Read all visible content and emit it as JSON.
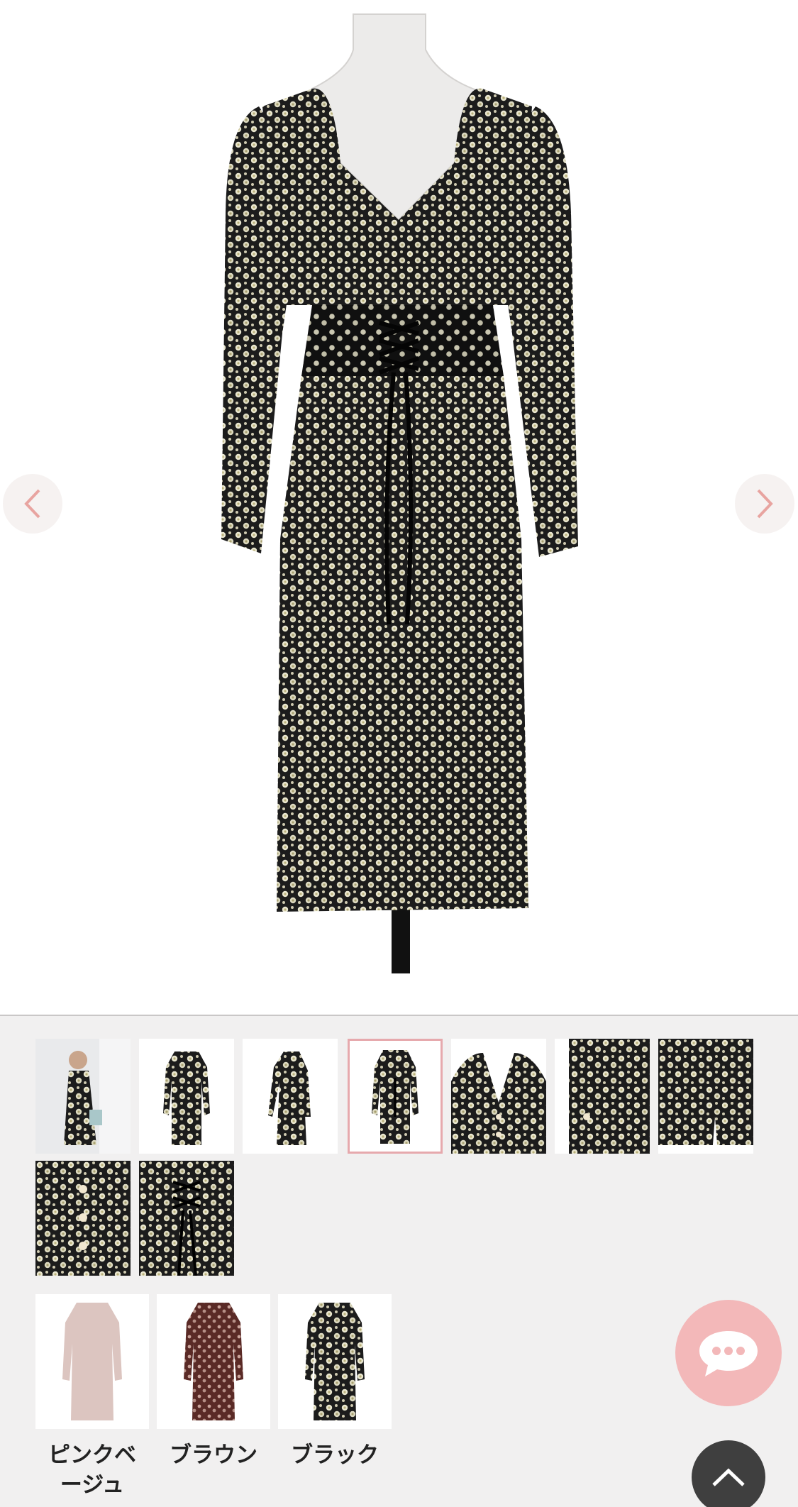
{
  "hero": {
    "prev_icon": "chevron-left-icon",
    "next_icon": "chevron-right-icon",
    "accent_color": "#e8a4a0"
  },
  "gallery": {
    "thumbnails": [
      {
        "name": "model-photo",
        "active": false
      },
      {
        "name": "front",
        "active": false
      },
      {
        "name": "side",
        "active": false
      },
      {
        "name": "back",
        "active": true
      },
      {
        "name": "neckline-detail",
        "active": false
      },
      {
        "name": "cuff-detail",
        "active": false
      },
      {
        "name": "hem-detail",
        "active": false
      },
      {
        "name": "button-detail",
        "active": false
      },
      {
        "name": "lace-up-detail",
        "active": false
      }
    ],
    "active_border_color": "#e6a9ad"
  },
  "colors": {
    "options": [
      {
        "label": "ピンクベージュ",
        "line1": "ピンクベ",
        "line2": "ージュ",
        "swatch": "#d9c2bd"
      },
      {
        "label": "ブラウン",
        "line1": "ブラウン",
        "line2": "",
        "swatch": "#6b3a34"
      },
      {
        "label": "ブラック",
        "line1": "ブラック",
        "line2": "",
        "swatch": "#2b2b2b"
      }
    ]
  },
  "floating": {
    "chat_icon": "chat-bubble-icon",
    "chat_color": "#f3b8b9",
    "top_icon": "chevron-up-icon",
    "top_color": "#3f3f3f"
  }
}
